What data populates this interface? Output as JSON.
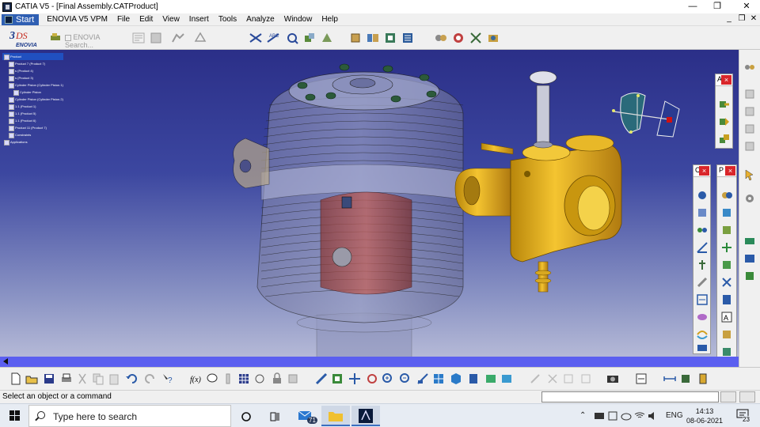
{
  "window": {
    "title": "CATIA V5 - [Final Assembly.CATProduct]",
    "minimize": "—",
    "restore": "❐",
    "close": "✕",
    "mdi_minimize": "_",
    "mdi_restore": "❐",
    "mdi_close": "✕"
  },
  "menu": {
    "start": "Start",
    "items": [
      "ENOVIA V5 VPM",
      "File",
      "Edit",
      "View",
      "Insert",
      "Tools",
      "Analyze",
      "Window",
      "Help"
    ]
  },
  "toolbar_top": {
    "enovia_search": "ENOVIA Search..."
  },
  "tree": {
    "nodes": [
      "Product",
      "Product 7 (Product 7)",
      "s (Product 4)",
      "s (Product 3)",
      "Cylinder Piston (Cylinder Piston.1)",
      "Cylinder Piston",
      "Cylinder Piston (Cylinder Piston.2)",
      "1.1 (Product 1)",
      "1.1 (Product 5)",
      "1.1 (Product 6)",
      "Product 11 (Product 7)",
      "Constraints",
      "Applications"
    ]
  },
  "floatbars": {
    "bar_a_label": "A",
    "bar_c_label": "C",
    "bar_p_label": "P",
    "close": "×"
  },
  "status": {
    "message": "Select an object or a command"
  },
  "taskbar": {
    "search_placeholder": "Type here to search",
    "mail_badge": "71",
    "language": "ENG",
    "time": "14:13",
    "date": "08-06-2021",
    "notification_count": "23"
  },
  "colors": {
    "viewport_top": "#2b2f88",
    "viewport_bottom": "#b6bad7",
    "part_gold": "#e8b020",
    "part_red": "#b0504c",
    "close_red": "#d9262a",
    "start_blue": "#2f5fb3"
  }
}
